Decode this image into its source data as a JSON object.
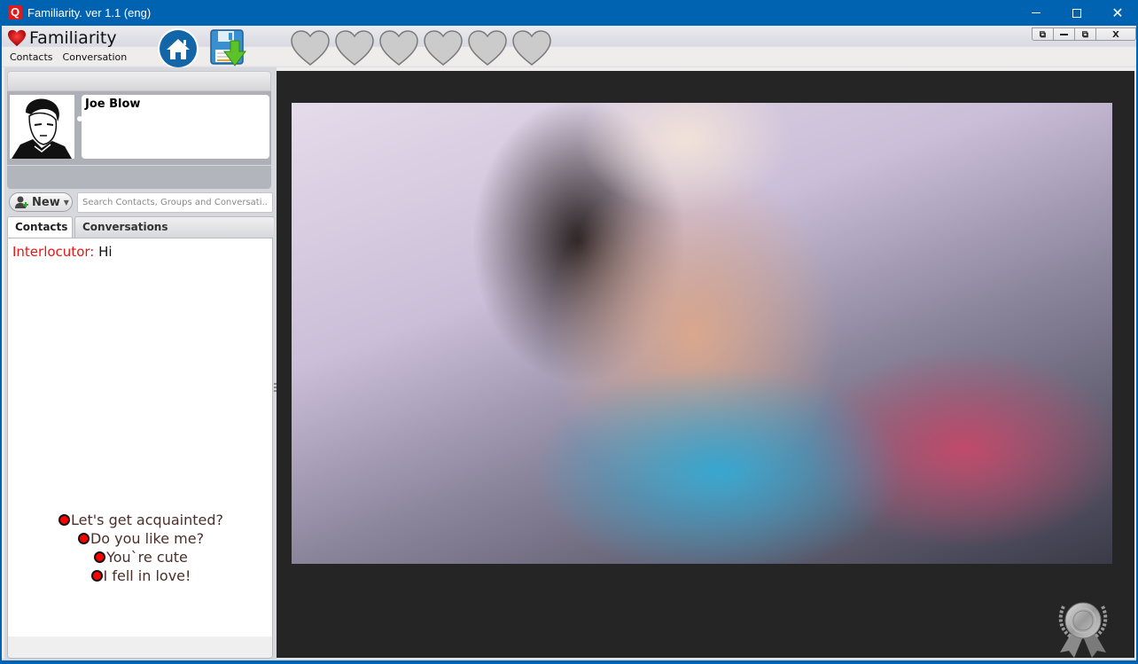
{
  "window": {
    "title": "Familiarity. ver 1.1 (eng)",
    "app_icon_glyph": "Q",
    "controls": {
      "minimize_icon": "minimize-icon",
      "maximize_icon": "maximize-icon",
      "close_glyph": "✕"
    }
  },
  "toolbar": {
    "brand_name": "Familiarity",
    "brand_icon": "heart-icon",
    "menu": [
      {
        "label": "Contacts"
      },
      {
        "label": "Conversation"
      }
    ],
    "home_icon": "home-icon",
    "save_icon": "save-download-icon",
    "rating": {
      "filled": 0,
      "total": 6,
      "icon": "heart-icon"
    },
    "mdi_controls": {
      "restore_glyph": "⧉",
      "minimize_glyph": "_",
      "cascade_glyph": "⧉",
      "close_glyph": "X"
    }
  },
  "profile": {
    "name": "Joe Blow",
    "avatar_icon": "avatar-sketch"
  },
  "contacts_toolbar": {
    "new_label": "New",
    "search_placeholder": "Search Contacts, Groups and Conversati..."
  },
  "tabs": [
    {
      "label": "Contacts",
      "active": true
    },
    {
      "label": "Conversations",
      "active": false
    }
  ],
  "chat": {
    "messages": [
      {
        "speaker": "Interlocutor:",
        "text": "Hi",
        "speaker_color": "#ee1111"
      }
    ],
    "suggestions": [
      {
        "label": "Let's get acquainted?"
      },
      {
        "label": "Do you like me?"
      },
      {
        "label": "You`re cute"
      },
      {
        "label": "I fell in love!"
      }
    ]
  },
  "video": {
    "description": "Webcam video feed",
    "award_icon": "medal-icon"
  },
  "colors": {
    "titlebar": "#0063b1",
    "accent_red": "#ff0000",
    "video_bg": "#252525",
    "home_blue": "#1266a8"
  }
}
